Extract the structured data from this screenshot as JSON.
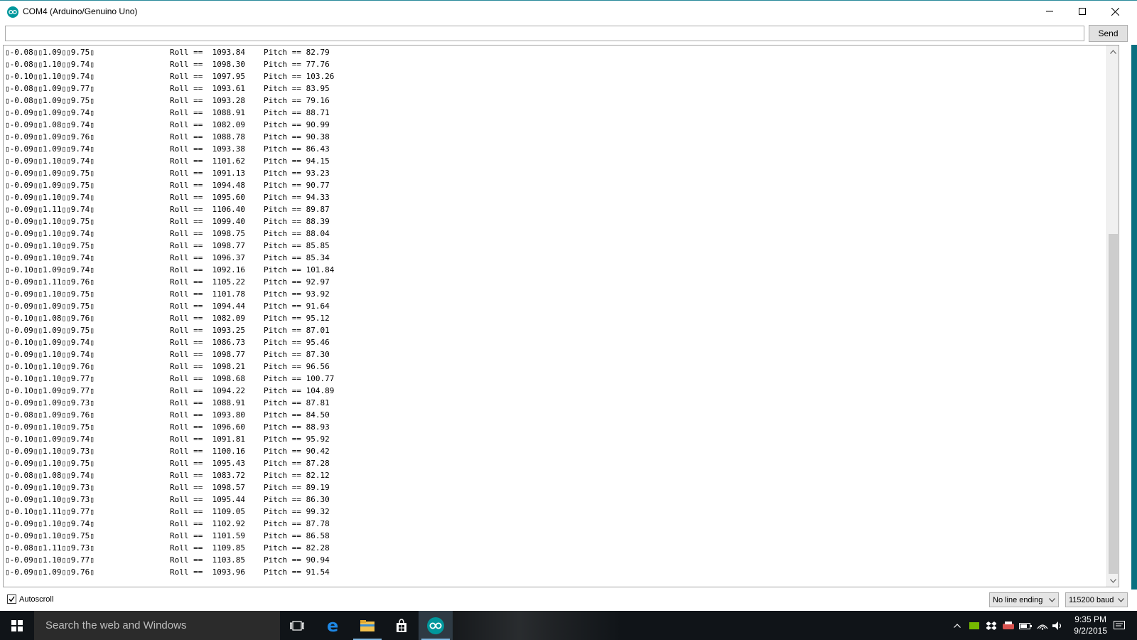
{
  "window": {
    "title": "COM4 (Arduino/Genuino Uno)",
    "icons": {
      "app": "arduino-icon",
      "minimize": "minimize-icon",
      "maximize": "maximize-icon",
      "close": "close-icon"
    }
  },
  "send": {
    "input_value": "",
    "button_label": "Send"
  },
  "serial_lines": [
    {
      "raw": "▯-0.08▯▯1.09▯▯9.75▯",
      "roll": "Roll ==  1093.84",
      "pitch": "Pitch == 82.79"
    },
    {
      "raw": "▯-0.08▯▯1.10▯▯9.74▯",
      "roll": "Roll ==  1098.30",
      "pitch": "Pitch == 77.76"
    },
    {
      "raw": "▯-0.10▯▯1.10▯▯9.74▯",
      "roll": "Roll ==  1097.95",
      "pitch": "Pitch == 103.26"
    },
    {
      "raw": "▯-0.08▯▯1.09▯▯9.77▯",
      "roll": "Roll ==  1093.61",
      "pitch": "Pitch == 83.95"
    },
    {
      "raw": "▯-0.08▯▯1.09▯▯9.75▯",
      "roll": "Roll ==  1093.28",
      "pitch": "Pitch == 79.16"
    },
    {
      "raw": "▯-0.09▯▯1.09▯▯9.74▯",
      "roll": "Roll ==  1088.91",
      "pitch": "Pitch == 88.71"
    },
    {
      "raw": "▯-0.09▯▯1.08▯▯9.74▯",
      "roll": "Roll ==  1082.09",
      "pitch": "Pitch == 90.99"
    },
    {
      "raw": "▯-0.09▯▯1.09▯▯9.76▯",
      "roll": "Roll ==  1088.78",
      "pitch": "Pitch == 90.38"
    },
    {
      "raw": "▯-0.09▯▯1.09▯▯9.74▯",
      "roll": "Roll ==  1093.38",
      "pitch": "Pitch == 86.43"
    },
    {
      "raw": "▯-0.09▯▯1.10▯▯9.74▯",
      "roll": "Roll ==  1101.62",
      "pitch": "Pitch == 94.15"
    },
    {
      "raw": "▯-0.09▯▯1.09▯▯9.75▯",
      "roll": "Roll ==  1091.13",
      "pitch": "Pitch == 93.23"
    },
    {
      "raw": "▯-0.09▯▯1.09▯▯9.75▯",
      "roll": "Roll ==  1094.48",
      "pitch": "Pitch == 90.77"
    },
    {
      "raw": "▯-0.09▯▯1.10▯▯9.74▯",
      "roll": "Roll ==  1095.60",
      "pitch": "Pitch == 94.33"
    },
    {
      "raw": "▯-0.09▯▯1.11▯▯9.74▯",
      "roll": "Roll ==  1106.40",
      "pitch": "Pitch == 89.87"
    },
    {
      "raw": "▯-0.09▯▯1.10▯▯9.75▯",
      "roll": "Roll ==  1099.40",
      "pitch": "Pitch == 88.39"
    },
    {
      "raw": "▯-0.09▯▯1.10▯▯9.74▯",
      "roll": "Roll ==  1098.75",
      "pitch": "Pitch == 88.04"
    },
    {
      "raw": "▯-0.09▯▯1.10▯▯9.75▯",
      "roll": "Roll ==  1098.77",
      "pitch": "Pitch == 85.85"
    },
    {
      "raw": "▯-0.09▯▯1.10▯▯9.74▯",
      "roll": "Roll ==  1096.37",
      "pitch": "Pitch == 85.34"
    },
    {
      "raw": "▯-0.10▯▯1.09▯▯9.74▯",
      "roll": "Roll ==  1092.16",
      "pitch": "Pitch == 101.84"
    },
    {
      "raw": "▯-0.09▯▯1.11▯▯9.76▯",
      "roll": "Roll ==  1105.22",
      "pitch": "Pitch == 92.97"
    },
    {
      "raw": "▯-0.09▯▯1.10▯▯9.75▯",
      "roll": "Roll ==  1101.78",
      "pitch": "Pitch == 93.92"
    },
    {
      "raw": "▯-0.09▯▯1.09▯▯9.75▯",
      "roll": "Roll ==  1094.44",
      "pitch": "Pitch == 91.64"
    },
    {
      "raw": "▯-0.10▯▯1.08▯▯9.76▯",
      "roll": "Roll ==  1082.09",
      "pitch": "Pitch == 95.12"
    },
    {
      "raw": "▯-0.09▯▯1.09▯▯9.75▯",
      "roll": "Roll ==  1093.25",
      "pitch": "Pitch == 87.01"
    },
    {
      "raw": "▯-0.10▯▯1.09▯▯9.74▯",
      "roll": "Roll ==  1086.73",
      "pitch": "Pitch == 95.46"
    },
    {
      "raw": "▯-0.09▯▯1.10▯▯9.74▯",
      "roll": "Roll ==  1098.77",
      "pitch": "Pitch == 87.30"
    },
    {
      "raw": "▯-0.10▯▯1.10▯▯9.76▯",
      "roll": "Roll ==  1098.21",
      "pitch": "Pitch == 96.56"
    },
    {
      "raw": "▯-0.10▯▯1.10▯▯9.77▯",
      "roll": "Roll ==  1098.68",
      "pitch": "Pitch == 100.77"
    },
    {
      "raw": "▯-0.10▯▯1.09▯▯9.77▯",
      "roll": "Roll ==  1094.22",
      "pitch": "Pitch == 104.89"
    },
    {
      "raw": "▯-0.09▯▯1.09▯▯9.73▯",
      "roll": "Roll ==  1088.91",
      "pitch": "Pitch == 87.81"
    },
    {
      "raw": "▯-0.08▯▯1.09▯▯9.76▯",
      "roll": "Roll ==  1093.80",
      "pitch": "Pitch == 84.50"
    },
    {
      "raw": "▯-0.09▯▯1.10▯▯9.75▯",
      "roll": "Roll ==  1096.60",
      "pitch": "Pitch == 88.93"
    },
    {
      "raw": "▯-0.10▯▯1.09▯▯9.74▯",
      "roll": "Roll ==  1091.81",
      "pitch": "Pitch == 95.92"
    },
    {
      "raw": "▯-0.09▯▯1.10▯▯9.73▯",
      "roll": "Roll ==  1100.16",
      "pitch": "Pitch == 90.42"
    },
    {
      "raw": "▯-0.09▯▯1.10▯▯9.75▯",
      "roll": "Roll ==  1095.43",
      "pitch": "Pitch == 87.28"
    },
    {
      "raw": "▯-0.08▯▯1.08▯▯9.74▯",
      "roll": "Roll ==  1083.72",
      "pitch": "Pitch == 82.12"
    },
    {
      "raw": "▯-0.09▯▯1.10▯▯9.73▯",
      "roll": "Roll ==  1098.57",
      "pitch": "Pitch == 89.19"
    },
    {
      "raw": "▯-0.09▯▯1.10▯▯9.73▯",
      "roll": "Roll ==  1095.44",
      "pitch": "Pitch == 86.30"
    },
    {
      "raw": "▯-0.10▯▯1.11▯▯9.77▯",
      "roll": "Roll ==  1109.05",
      "pitch": "Pitch == 99.32"
    },
    {
      "raw": "▯-0.09▯▯1.10▯▯9.74▯",
      "roll": "Roll ==  1102.92",
      "pitch": "Pitch == 87.78"
    },
    {
      "raw": "▯-0.09▯▯1.10▯▯9.75▯",
      "roll": "Roll ==  1101.59",
      "pitch": "Pitch == 86.58"
    },
    {
      "raw": "▯-0.08▯▯1.11▯▯9.73▯",
      "roll": "Roll ==  1109.85",
      "pitch": "Pitch == 82.28"
    },
    {
      "raw": "▯-0.09▯▯1.10▯▯9.77▯",
      "roll": "Roll ==  1103.85",
      "pitch": "Pitch == 90.94"
    },
    {
      "raw": "▯-0.09▯▯1.09▯▯9.76▯",
      "roll": "Roll ==  1093.96",
      "pitch": "Pitch == 91.54"
    }
  ],
  "bottom": {
    "autoscroll_label": "Autoscroll",
    "autoscroll_checked": true,
    "line_ending": "No line ending",
    "baud_rate": "115200 baud"
  },
  "taskbar": {
    "search_placeholder": "Search the web and Windows",
    "time": "9:35 PM",
    "date": "9/2/2015",
    "apps": [
      "task-view-icon",
      "edge-icon",
      "file-explorer-icon",
      "store-icon",
      "arduino-icon"
    ]
  },
  "colors": {
    "arduino_teal": "#00979c",
    "taskbar": "#101418"
  }
}
